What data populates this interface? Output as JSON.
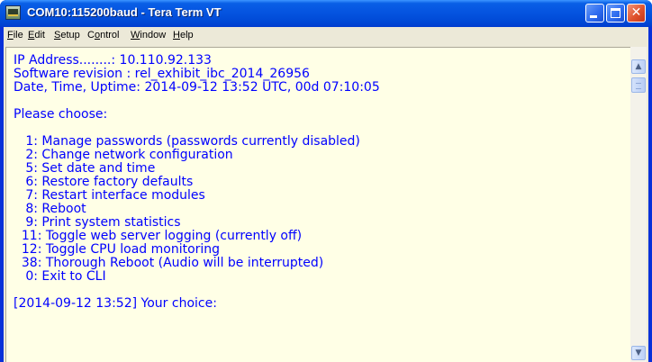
{
  "window": {
    "title": "COM10:115200baud - Tera Term VT",
    "close_glyph": "✕"
  },
  "menu": {
    "items": [
      {
        "underline": "F",
        "rest": "ile"
      },
      {
        "underline": "E",
        "rest": "dit"
      },
      {
        "underline": "S",
        "rest": "etup"
      },
      {
        "prefix": "C",
        "underline": "o",
        "rest": "ntrol"
      },
      {
        "underline": "W",
        "rest": "indow"
      },
      {
        "underline": "H",
        "rest": "elp"
      }
    ]
  },
  "terminal": {
    "lines": [
      "IP Address........: 10.110.92.133",
      "Software revision : rel_exhibit_ibc_2014_26956",
      "Date, Time, Uptime: 2014-09-12 13:52 UTC, 00d 07:10:05",
      "Please choose:",
      "   1: Manage passwords (passwords currently disabled)",
      "   2: Change network configuration",
      "   5: Set date and time",
      "   6: Restore factory defaults",
      "   7: Restart interface modules",
      "   8: Reboot",
      "   9: Print system statistics",
      "  11: Toggle web server logging (currently off)",
      "  12: Toggle CPU load monitoring",
      "  38: Thorough Reboot (Audio will be interrupted)",
      "   0: Exit to CLI",
      "[2014-09-12 13:52] Your choice:"
    ]
  },
  "scrollbar": {
    "up_glyph": "▲",
    "down_glyph": "▼"
  }
}
